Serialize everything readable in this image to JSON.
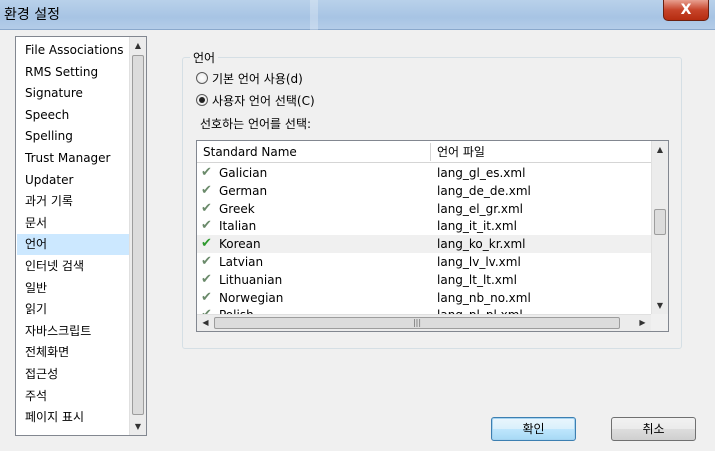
{
  "window": {
    "title": "환경 설정",
    "close_label": "X"
  },
  "sidebar": {
    "items": [
      {
        "label": "File Associations",
        "selected": false
      },
      {
        "label": "RMS Setting",
        "selected": false
      },
      {
        "label": "Signature",
        "selected": false
      },
      {
        "label": "Speech",
        "selected": false
      },
      {
        "label": "Spelling",
        "selected": false
      },
      {
        "label": "Trust Manager",
        "selected": false
      },
      {
        "label": "Updater",
        "selected": false
      },
      {
        "label": "과거 기록",
        "selected": false
      },
      {
        "label": "문서",
        "selected": false
      },
      {
        "label": "언어",
        "selected": true
      },
      {
        "label": "인터넷 검색",
        "selected": false
      },
      {
        "label": "일반",
        "selected": false
      },
      {
        "label": "읽기",
        "selected": false
      },
      {
        "label": "자바스크립트",
        "selected": false
      },
      {
        "label": "전체화면",
        "selected": false
      },
      {
        "label": "접근성",
        "selected": false
      },
      {
        "label": "주석",
        "selected": false
      },
      {
        "label": "페이지 표시",
        "selected": false
      }
    ]
  },
  "language_panel": {
    "group_title": "언어",
    "radio_default": "기본 언어 사용(d)",
    "radio_user": "사용자 언어 선택(C)",
    "radio_user_checked": true,
    "prompt": "선호하는 언어를 선택:",
    "table": {
      "columns": [
        "Standard Name",
        "언어 파일"
      ],
      "rows": [
        {
          "name": "Galician",
          "file": "lang_gl_es.xml",
          "selected": false
        },
        {
          "name": "German",
          "file": "lang_de_de.xml",
          "selected": false
        },
        {
          "name": "Greek",
          "file": "lang_el_gr.xml",
          "selected": false
        },
        {
          "name": "Italian",
          "file": "lang_it_it.xml",
          "selected": false
        },
        {
          "name": "Korean",
          "file": "lang_ko_kr.xml",
          "selected": true
        },
        {
          "name": "Latvian",
          "file": "lang_lv_lv.xml",
          "selected": false
        },
        {
          "name": "Lithuanian",
          "file": "lang_lt_lt.xml",
          "selected": false
        },
        {
          "name": "Norwegian",
          "file": "lang_nb_no.xml",
          "selected": false
        },
        {
          "name": "Polish",
          "file": "lang_pl_pl.xml",
          "selected": false
        }
      ]
    }
  },
  "buttons": {
    "ok": "확인",
    "cancel": "취소"
  },
  "icons": {
    "check": "check-icon",
    "scroll_up": "arrow-up-icon",
    "scroll_down": "arrow-down-icon",
    "scroll_left": "arrow-left-icon",
    "scroll_right": "arrow-right-icon"
  }
}
